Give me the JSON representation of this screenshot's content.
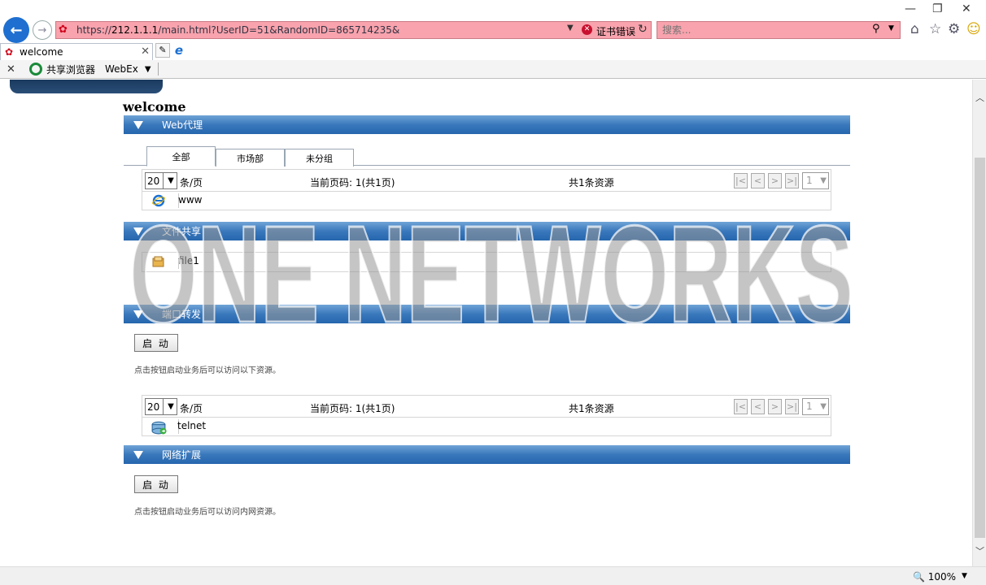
{
  "browser": {
    "address_prefix": "https://",
    "address_host": "212.1.1.1",
    "address_path": "/main.html?UserID=51&RandomID=865714235&",
    "cert_error": "证书错误",
    "search_placeholder": "搜索...",
    "tab_title": "welcome",
    "fav_share": "共享浏览器",
    "fav_webex": "WebEx",
    "zoom": "100%"
  },
  "page": {
    "welcome": "welcome",
    "sections": {
      "web_proxy": "Web代理",
      "file_share": "文件共享",
      "port_forward": "端口转发",
      "network_ext": "网络扩展"
    },
    "tabs": [
      "全部",
      "市场部",
      "未分组"
    ],
    "pager": {
      "per_page_value": "20",
      "per_page_label": "条/页",
      "current_page": "当前页码: 1(共1页)",
      "total": "共1条资源",
      "first": "|<",
      "prev": "<",
      "next": ">",
      "last": ">|",
      "page_value": "1"
    },
    "resources": {
      "web": "www",
      "file": "file1",
      "port": "telnet"
    },
    "start_label": "启 动",
    "hint_port": "点击按钮启动业务后可以访问以下资源。",
    "hint_net": "点击按钮启动业务后可以访问内网资源。",
    "watermark": "ONE NETWORKS"
  },
  "colors": {
    "section_bar": "#3a78bc",
    "address_bg": "#f8a3ad",
    "back_button": "#1e6fd0"
  }
}
